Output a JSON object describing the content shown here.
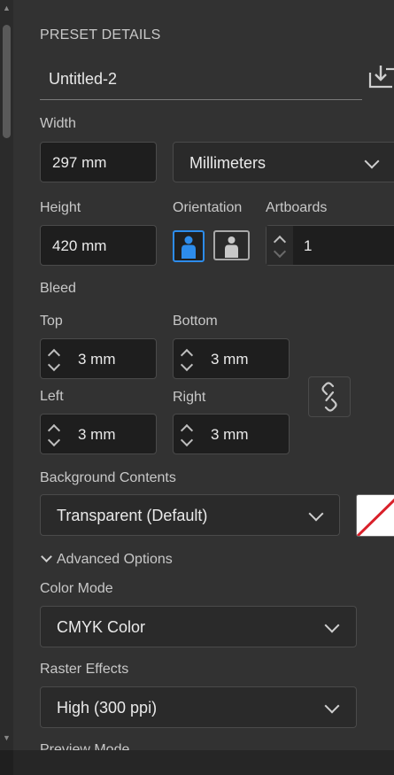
{
  "preset": {
    "section_title": "PRESET DETAILS",
    "name": "Untitled-2"
  },
  "width": {
    "label": "Width",
    "value": "297 mm"
  },
  "units": {
    "selected": "Millimeters"
  },
  "height": {
    "label": "Height",
    "value": "420 mm"
  },
  "orientation": {
    "label": "Orientation",
    "selected": "portrait"
  },
  "artboards": {
    "label": "Artboards",
    "value": "1"
  },
  "bleed": {
    "label": "Bleed",
    "top": {
      "label": "Top",
      "value": "3 mm"
    },
    "bottom": {
      "label": "Bottom",
      "value": "3 mm"
    },
    "left": {
      "label": "Left",
      "value": "3 mm"
    },
    "right": {
      "label": "Right",
      "value": "3 mm"
    }
  },
  "background": {
    "label": "Background Contents",
    "selected": "Transparent (Default)"
  },
  "advanced": {
    "label": "Advanced Options"
  },
  "color_mode": {
    "label": "Color Mode",
    "selected": "CMYK Color"
  },
  "raster": {
    "label": "Raster Effects",
    "selected": "High (300 ppi)"
  },
  "preview_mode": {
    "label": "Preview Mode"
  },
  "colors": {
    "accent": "#2d8ceb",
    "panel": "#323232",
    "field": "#1e1e1e",
    "swatch_slash": "#d9202a"
  }
}
